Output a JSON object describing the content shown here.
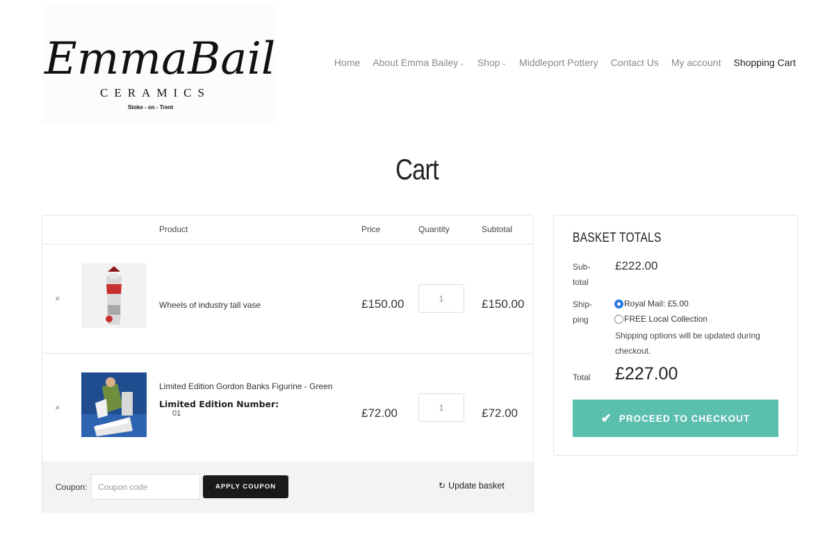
{
  "logo": {
    "script": "EmmaBailey",
    "brand_sub": "CERAMICS",
    "location": "Stoke - on - Trent"
  },
  "nav": {
    "items": [
      {
        "label": "Home",
        "has_dropdown": false
      },
      {
        "label": "About Emma Bailey",
        "has_dropdown": true
      },
      {
        "label": "Shop",
        "has_dropdown": true
      },
      {
        "label": "Middleport Pottery",
        "has_dropdown": false
      },
      {
        "label": "Contact Us",
        "has_dropdown": false
      },
      {
        "label": "My account",
        "has_dropdown": false
      },
      {
        "label": "Shopping Cart",
        "has_dropdown": false,
        "active": true
      }
    ],
    "chevron_icon": "chevron-down-icon"
  },
  "page": {
    "title": "Cart"
  },
  "cart": {
    "headers": {
      "product": "Product",
      "price": "Price",
      "quantity": "Quantity",
      "subtotal": "Subtotal"
    },
    "remove_symbol": "×",
    "items": [
      {
        "name": "Wheels of industry tall vase",
        "price": "£150.00",
        "quantity": "1",
        "subtotal": "£150.00"
      },
      {
        "name": "Limited Edition Gordon Banks Figurine - Green",
        "meta_label": "Limited Edition Number:",
        "meta_value": "01",
        "price": "£72.00",
        "quantity": "1",
        "subtotal": "£72.00"
      }
    ],
    "coupon": {
      "label": "Coupon:",
      "placeholder": "Coupon code",
      "value": "",
      "apply_label": "APPLY COUPON"
    },
    "update_label": "Update basket",
    "update_icon": "refresh-icon"
  },
  "totals": {
    "title": "BASKET TOTALS",
    "subtotal_label": "Sub-total",
    "subtotal_value": "£222.00",
    "shipping_label": "Ship-ping",
    "shipping_options": [
      {
        "label": "Royal Mail: £5.00",
        "selected": true
      },
      {
        "label": "FREE Local Collection",
        "selected": false
      }
    ],
    "shipping_note": "Shipping options will be updated during checkout.",
    "total_label": "Total",
    "total_value": "£227.00",
    "checkout_label": "PROCEED TO CHECKOUT",
    "checkout_icon": "check-icon"
  },
  "colors": {
    "accent": "#5bbfb0",
    "button_dark": "#1a1a1a",
    "radio_selected": "#2a7ae2"
  }
}
